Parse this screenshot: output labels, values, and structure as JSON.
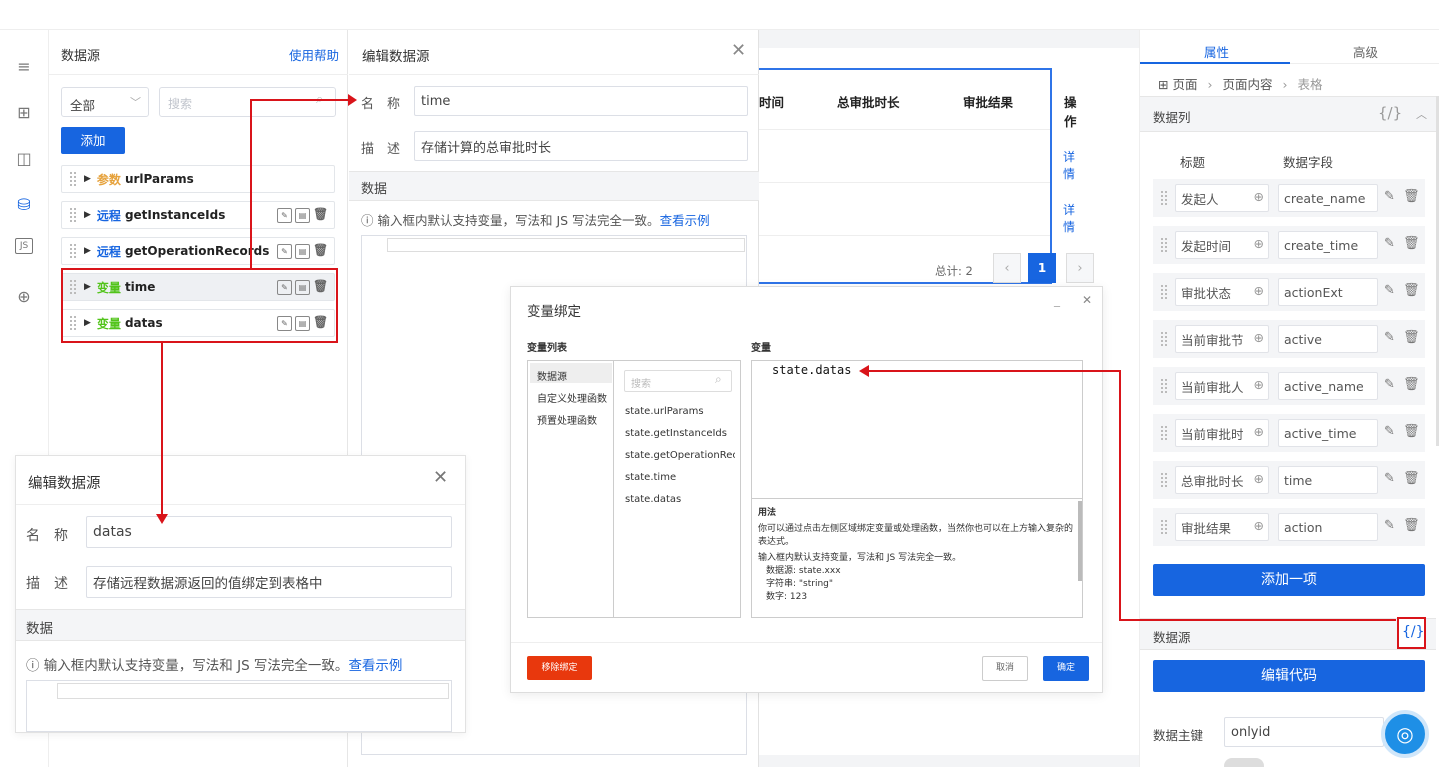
{
  "datasource_panel": {
    "title": "数据源",
    "help": "使用帮助",
    "filter_value": "全部",
    "search_placeholder": "搜索",
    "add_label": "添加",
    "items": [
      {
        "tag": "参数",
        "tag_color": "#e6a23c",
        "name": "urlParams"
      },
      {
        "tag": "远程",
        "tag_color": "#1765e0",
        "name": "getInstanceIds"
      },
      {
        "tag": "远程",
        "tag_color": "#1765e0",
        "name": "getOperationRecords"
      },
      {
        "tag": "变量",
        "tag_color": "#52c41a",
        "name": "time"
      },
      {
        "tag": "变量",
        "tag_color": "#52c41a",
        "name": "datas"
      }
    ]
  },
  "edit_top": {
    "title": "编辑数据源",
    "name_label": "名　称",
    "name_value": "time",
    "desc_label": "描　述",
    "desc_value": "存储计算的总审批时长",
    "section": "数据",
    "hint": "输入框内默认支持变量，写法和 JS 写法完全一致。",
    "hint_link": "查看示例"
  },
  "table": {
    "headers": [
      "时间",
      "总审批时长",
      "审批结果",
      "操作"
    ],
    "rows": [
      {
        "action": "详情"
      },
      {
        "action": "详情"
      }
    ],
    "total": "总计: 2",
    "page": "1"
  },
  "var_bind": {
    "title": "变量绑定",
    "list_title": "变量列表",
    "var_title": "变量",
    "categories": [
      "数据源",
      "自定义处理函数",
      "预置处理函数"
    ],
    "search_placeholder": "搜索",
    "vars": [
      "state.urlParams",
      "state.getInstanceIds",
      "state.getOperationReco...",
      "state.time",
      "state.datas"
    ],
    "code_prefix": "state",
    "code_suffix": ".datas",
    "usage_title": "用法",
    "usage_1": "你可以通过点击左侧区域绑定变量或处理函数，当然你也可以在上方输入复杂的表达式。",
    "usage_2": "输入框内默认支持变量，写法和 JS 写法完全一致。",
    "usage_3": "数据源: state.xxx",
    "usage_4": "字符串: \"string\"",
    "usage_5": "数字: 123",
    "remove": "移除绑定",
    "cancel": "取消",
    "ok": "确定"
  },
  "right_panel": {
    "tab_props": "属性",
    "tab_adv": "高级",
    "crumb": [
      "页面",
      "页面内容",
      "表格"
    ],
    "columns_title": "数据列",
    "code_icon": "{/}",
    "col_title": "标题",
    "col_field": "数据字段",
    "columns": [
      {
        "title": "发起人",
        "field": "create_name"
      },
      {
        "title": "发起时间",
        "field": "create_time"
      },
      {
        "title": "审批状态",
        "field": "actionExt"
      },
      {
        "title": "当前审批节",
        "field": "active"
      },
      {
        "title": "当前审批人",
        "field": "active_name"
      },
      {
        "title": "当前审批时",
        "field": "active_time"
      },
      {
        "title": "总审批时长",
        "field": "time"
      },
      {
        "title": "审批结果",
        "field": "action"
      }
    ],
    "add_item": "添加一项",
    "ds_title": "数据源",
    "edit_code": "编辑代码",
    "key_label": "数据主键",
    "key_value": "onlyid"
  },
  "edit_bottom": {
    "title": "编辑数据源",
    "name_label": "名　称",
    "name_value": "datas",
    "desc_label": "描　述",
    "desc_value": "存储远程数据源返回的值绑定到表格中",
    "section": "数据",
    "hint": "输入框内默认支持变量，写法和 JS 写法完全一致。",
    "hint_link": "查看示例"
  }
}
